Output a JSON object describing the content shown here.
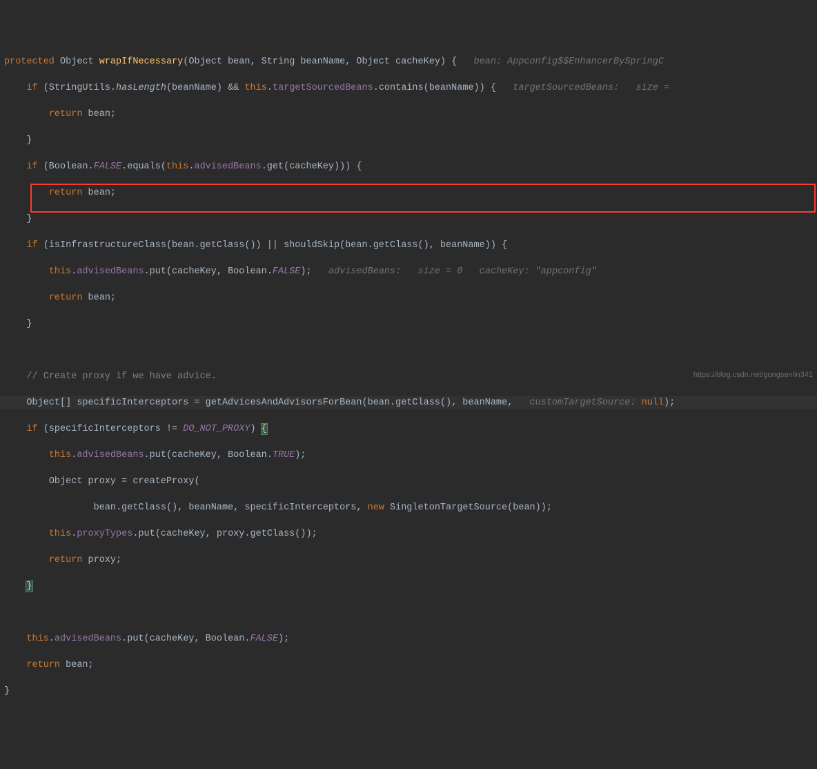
{
  "code": {
    "l1_kw1": "protected",
    "l1_type": " Object ",
    "l1_method": "wrapIfNecessary",
    "l1_sig": "(Object bean, String beanName, Object cacheKey) {",
    "l1_hint": "   bean: Appconfig$$EnhancerBySpringC",
    "l2_kw": "if",
    "l2_a": " (StringUtils.",
    "l2_has": "hasLength",
    "l2_b": "(beanName) && ",
    "l2_this": "this",
    "l2_c": ".",
    "l2_field": "targetSourcedBeans",
    "l2_d": ".contains(beanName)) {",
    "l2_hint": "   targetSourcedBeans:   size =",
    "l3_kw": "return",
    "l3_a": " bean;",
    "l4": "}",
    "l5_kw": "if",
    "l5_a": " (Boolean.",
    "l5_false": "FALSE",
    "l5_b": ".equals(",
    "l5_this": "this",
    "l5_c": ".",
    "l5_field": "advisedBeans",
    "l5_d": ".get(cacheKey))) {",
    "l6_kw": "return",
    "l6_a": " bean;",
    "l7": "}",
    "l8_kw": "if",
    "l8_a": " (isInfrastructureClass(bean.getClass()) || shouldSkip(bean.getClass(), beanName)) {",
    "l9_this": "this",
    "l9_a": ".",
    "l9_field": "advisedBeans",
    "l9_b": ".put(cacheKey, Boolean.",
    "l9_false": "FALSE",
    "l9_c": ");",
    "l9_hint": "   advisedBeans:   size = 0   cacheKey: \"appconfig\"",
    "l10_kw": "return",
    "l10_a": " bean;",
    "l11": "}",
    "l12_comment": "// Create proxy if we have advice.",
    "l13_a": "Object[] specificInterceptors = getAdvicesAndAdvisorsForBean(bean.getClass(), beanName, ",
    "l13_hint": "  customTargetSource:",
    "l13_null": " null",
    "l13_b": ");",
    "l14_kw": "if",
    "l14_a": " (specificInterceptors != ",
    "l14_const": "DO_NOT_PROXY",
    "l14_b": ") ",
    "l14_brace": "{",
    "l15_this": "this",
    "l15_a": ".",
    "l15_field": "advisedBeans",
    "l15_b": ".put(cacheKey, Boolean.",
    "l15_true": "TRUE",
    "l15_c": ");",
    "l16_a": "Object proxy = createProxy(",
    "l17_a": "bean.getClass(), beanName, specificInterceptors, ",
    "l17_new": "new",
    "l17_b": " SingletonTargetSource(bean));",
    "l18_this": "this",
    "l18_a": ".",
    "l18_field": "proxyTypes",
    "l18_b": ".put(cacheKey, proxy.getClass());",
    "l19_kw": "return",
    "l19_a": " proxy;",
    "l20": "}",
    "l21_this": "this",
    "l21_a": ".",
    "l21_field": "advisedBeans",
    "l21_b": ".put(cacheKey, Boolean.",
    "l21_false": "FALSE",
    "l21_c": ");",
    "l22_kw": "return",
    "l22_a": " bean;",
    "l23": "}"
  },
  "watermark": "https://blog.csdn.net/gongsenlin341"
}
